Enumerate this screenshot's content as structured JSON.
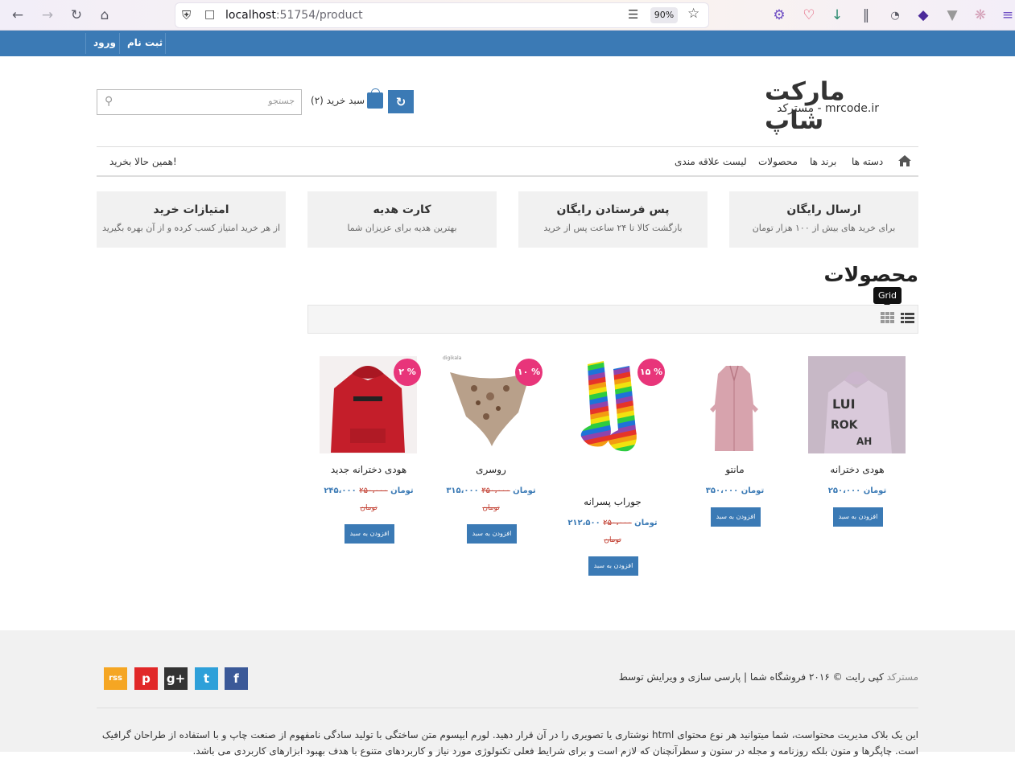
{
  "browser": {
    "url_host": "localhost",
    "url_port": ":51754/product",
    "zoom": "90%"
  },
  "topbar": {
    "login": "ورود",
    "register": "ثبت نام"
  },
  "logo": {
    "title": "مارکت شاپ",
    "subtitle": "مسترکد - mrcode.ir"
  },
  "header": {
    "cart_label": "سبد خرید (۲)",
    "search_placeholder": "جستجو"
  },
  "nav": {
    "items": [
      "دسته ها",
      "برند ها",
      "محصولات",
      "لیست علاقه مندی"
    ],
    "cta": "همین حالا بخرید!"
  },
  "features": [
    {
      "title": "ارسال رایگان",
      "desc": "برای خرید های بیش از ۱۰۰ هزار تومان"
    },
    {
      "title": "پس فرستادن رایگان",
      "desc": "بازگشت کالا تا ۲۴ ساعت پس از خرید"
    },
    {
      "title": "کارت هدیه",
      "desc": "بهترین هدیه برای عزیزان شما"
    },
    {
      "title": "امتیازات خرید",
      "desc": "از هر خرید امتیاز کسب کرده و از آن بهره بگیرید"
    }
  ],
  "page_title": "محصولات",
  "tooltip": "Grid",
  "products": [
    {
      "name": "هودی دخترانه",
      "price": "۲۵۰،۰۰۰ تومان",
      "old_price": "",
      "old_unit": "",
      "discount": "",
      "button": "افزودن به سبد"
    },
    {
      "name": "مانتو",
      "price": "۳۵۰،۰۰۰ تومان",
      "old_price": "",
      "old_unit": "",
      "discount": "",
      "button": "افزودن به سبد"
    },
    {
      "name": "جوراب پسرانه",
      "price": "۲۱۲،۵۰۰ تومان",
      "old_price": "۲۵۰،۰۰۰",
      "old_unit": "تومان",
      "discount": "۱۵ %",
      "button": "افزودن به سبد"
    },
    {
      "name": "روسری",
      "price": "۳۱۵،۰۰۰ تومان",
      "old_price": "۳۵۰،۰۰۰",
      "old_unit": "تومان",
      "discount": "۱۰ %",
      "button": "افزودن به سبد"
    },
    {
      "name": "هودی دخترانه جدید",
      "price": "۲۴۵،۰۰۰ تومان",
      "old_price": "۲۵۰،۰۰۰",
      "old_unit": "تومان",
      "discount": "۲ %",
      "button": "افزودن به سبد"
    }
  ],
  "image_label": "digikala",
  "footer": {
    "copyright": "کپی رایت © ۲۰۱۶ فروشگاه شما | پارسی سازی و ویرایش توسط",
    "brand": "مسترکد",
    "social": [
      "f",
      "t",
      "g+",
      "p",
      "rss"
    ],
    "text": "این یک بلاک مدیریت محتواست، شما میتوانید هر نوع محتوای html نوشتاری یا تصویری را در آن قرار دهید. لورم ایپسوم متن ساختگی با تولید سادگی نامفهوم از صنعت چاپ و با استفاده از طراحان گرافیک است. چاپگرها و متون بلکه روزنامه و مجله در ستون و سطرآنچنان که لازم است و برای شرایط فعلی تکنولوژی مورد نیاز و کاربردهای متنوع با هدف بهبود ابزارهای کاربردی می باشد."
  },
  "colors": {
    "primary": "#3b7ab5",
    "badge": "#e8357a",
    "old_price": "#c0392b"
  }
}
